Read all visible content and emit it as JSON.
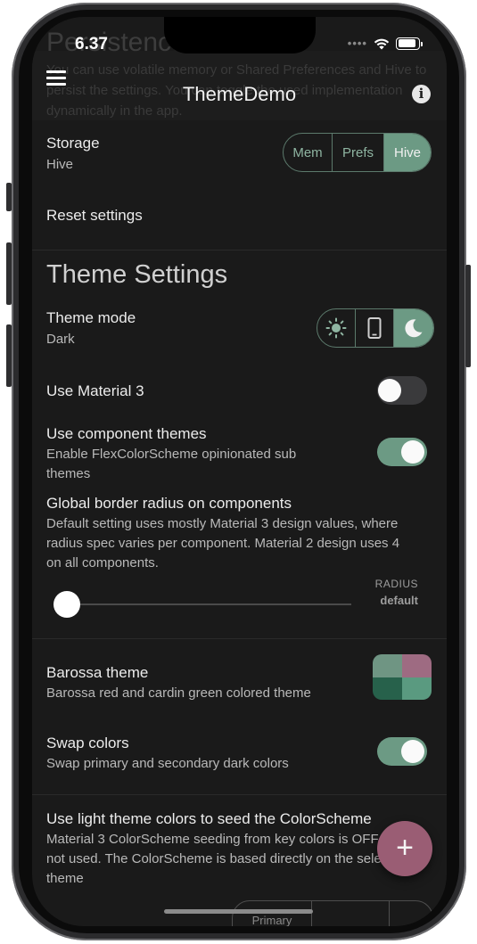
{
  "status_bar": {
    "time": "6.37",
    "signal": "••••"
  },
  "app_bar": {
    "title": "ThemeDemo",
    "ghost_heading": "Persistence",
    "ghost_text": "You can use volatile memory or Shared Preferences and Hive to persist the settings. You can toggle the used implementation dynamically in the app."
  },
  "storage": {
    "title": "Storage",
    "value": "Hive",
    "options": [
      {
        "label": "Mem",
        "selected": false
      },
      {
        "label": "Prefs",
        "selected": false
      },
      {
        "label": "Hive",
        "selected": true
      }
    ]
  },
  "reset": {
    "label": "Reset settings"
  },
  "theme_settings": {
    "heading": "Theme Settings",
    "theme_mode": {
      "title": "Theme mode",
      "value": "Dark",
      "selected": "dark",
      "icons": [
        "sun-icon",
        "phone-icon",
        "moon-icon"
      ]
    },
    "material3": {
      "title": "Use Material 3",
      "on": false
    },
    "component_themes": {
      "title": "Use component themes",
      "subtitle": "Enable FlexColorScheme opinionated sub themes",
      "on": true
    },
    "border_radius": {
      "title": "Global border radius on components",
      "subtitle": "Default setting uses mostly Material 3 design values, where radius spec varies per component. Material 2 design uses 4 on all components.",
      "label": "RADIUS",
      "value": "default",
      "position": 0
    }
  },
  "theme": {
    "title": "Barossa theme",
    "subtitle": "Barossa red and cardin green colored theme",
    "swatch_colors": [
      "#6f9583",
      "#9e6b82",
      "#27614b",
      "#5a9a80"
    ]
  },
  "swap": {
    "title": "Swap colors",
    "subtitle": "Swap primary and secondary dark colors",
    "on": true
  },
  "seed": {
    "title": "Use light theme colors to seed the ColorScheme",
    "subtitle": "Material 3 ColorScheme seeding from key colors is OFF and not used. The ColorScheme is based directly on the selected theme"
  },
  "bottom_segment": {
    "first_label": "Primary"
  },
  "colors": {
    "accent": "#6c9a84",
    "fab": "#9a5d74",
    "background": "#1a1a1a"
  }
}
